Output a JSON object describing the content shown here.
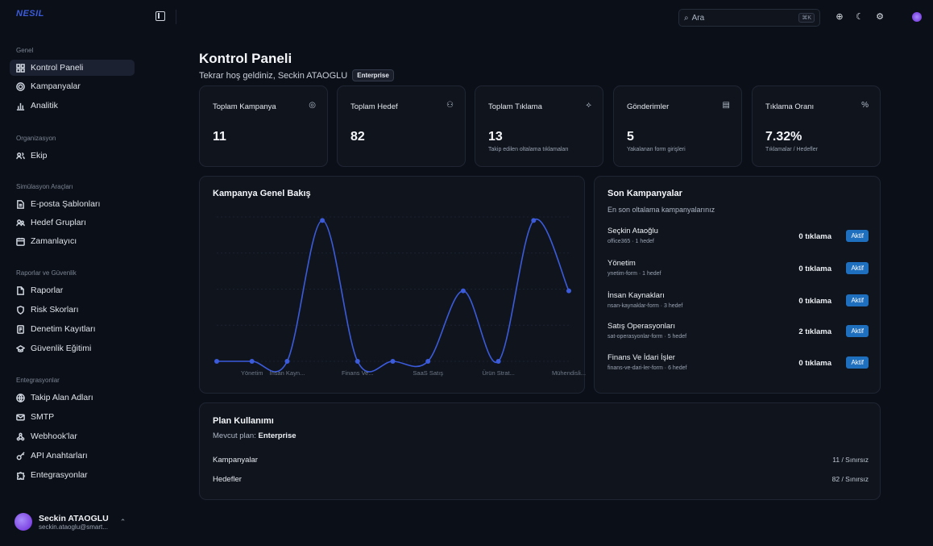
{
  "brand": "NESIL",
  "sidebar": {
    "sections": [
      {
        "title": "Genel",
        "items": [
          {
            "label": "Kontrol Paneli",
            "icon": "dashboard-icon",
            "active": true
          },
          {
            "label": "Kampanyalar",
            "icon": "target-icon"
          },
          {
            "label": "Analitik",
            "icon": "bar-chart-icon"
          }
        ]
      },
      {
        "title": "Organizasyon",
        "items": [
          {
            "label": "Ekip",
            "icon": "users-icon"
          }
        ]
      },
      {
        "title": "Simülasyon Araçları",
        "items": [
          {
            "label": "E-posta Şablonları",
            "icon": "file-icon"
          },
          {
            "label": "Hedef Grupları",
            "icon": "group-icon"
          },
          {
            "label": "Zamanlayıcı",
            "icon": "calendar-icon"
          }
        ]
      },
      {
        "title": "Raporlar ve Güvenlik",
        "items": [
          {
            "label": "Raporlar",
            "icon": "report-icon"
          },
          {
            "label": "Risk Skorları",
            "icon": "shield-icon"
          },
          {
            "label": "Denetim Kayıtları",
            "icon": "log-icon"
          },
          {
            "label": "Güvenlik Eğitimi",
            "icon": "graduation-icon"
          }
        ]
      },
      {
        "title": "Entegrasyonlar",
        "items": [
          {
            "label": "Takip Alan Adları",
            "icon": "globe-icon"
          },
          {
            "label": "SMTP",
            "icon": "mail-icon"
          },
          {
            "label": "Webhook'lar",
            "icon": "webhook-icon"
          },
          {
            "label": "API Anahtarları",
            "icon": "key-icon"
          },
          {
            "label": "Entegrasyonlar",
            "icon": "puzzle-icon"
          }
        ]
      }
    ],
    "user": {
      "name": "Seckin ATAOGLU",
      "email": "seckin.ataoglu@smart..."
    }
  },
  "header": {
    "search_placeholder": "Ara",
    "search_shortcut": "⌘K"
  },
  "page": {
    "title": "Kontrol Paneli",
    "welcome": "Tekrar hoş geldiniz, Seckin ATAOGLU",
    "plan_badge": "Enterprise"
  },
  "stats": [
    {
      "label": "Toplam Kampanya",
      "value": "11",
      "sub": "",
      "icon": "target-icon"
    },
    {
      "label": "Toplam Hedef",
      "value": "82",
      "sub": "",
      "icon": "users-icon"
    },
    {
      "label": "Toplam Tıklama",
      "value": "13",
      "sub": "Takip edilen oltalama tıklamaları",
      "icon": "click-icon"
    },
    {
      "label": "Gönderimler",
      "value": "5",
      "sub": "Yakalanan form girişleri",
      "icon": "file-icon"
    },
    {
      "label": "Tıklama Oranı",
      "value": "7.32%",
      "sub": "Tıklamalar / Hedefler",
      "icon": "percent-icon"
    }
  ],
  "overview": {
    "title": "Kampanya Genel Bakış",
    "chart_data": {
      "type": "line",
      "categories": [
        "",
        "Yönetim",
        "İnsan Kayn...",
        "",
        "Finans Ve...",
        "",
        "SaaS Satış",
        "",
        "Ürün Strat...",
        "",
        "Mühendisli..."
      ],
      "values": [
        0,
        0,
        0,
        2,
        0,
        0,
        0,
        1,
        0,
        2,
        1
      ],
      "ylim": [
        0,
        2.05
      ],
      "grid": true,
      "color": "#3b5bdb"
    }
  },
  "recent": {
    "title": "Son Kampanyalar",
    "subtitle": "En son oltalama kampanyalarınız",
    "items": [
      {
        "name": "Seçkin Ataoğlu",
        "meta": "office365 · 1 hedef",
        "clicks": "0 tıklama",
        "status": "Aktif"
      },
      {
        "name": "Yönetim",
        "meta": "ynetim-form · 1 hedef",
        "clicks": "0 tıklama",
        "status": "Aktif"
      },
      {
        "name": "İnsan Kaynakları",
        "meta": "nsan-kaynaklar-form · 3 hedef",
        "clicks": "0 tıklama",
        "status": "Aktif"
      },
      {
        "name": "Satış Operasyonları",
        "meta": "sat-operasyonlar-form · 5 hedef",
        "clicks": "2 tıklama",
        "status": "Aktif"
      },
      {
        "name": "Finans Ve İdari İşler",
        "meta": "finans-ve-dari-ler-form · 6 hedef",
        "clicks": "0 tıklama",
        "status": "Aktif"
      }
    ]
  },
  "plan": {
    "title": "Plan Kullanımı",
    "current_label": "Mevcut plan:",
    "current_value": "Enterprise",
    "rows": [
      {
        "label": "Kampanyalar",
        "value": "11 / Sınırsız"
      },
      {
        "label": "Hedefler",
        "value": "82 / Sınırsız"
      }
    ]
  }
}
